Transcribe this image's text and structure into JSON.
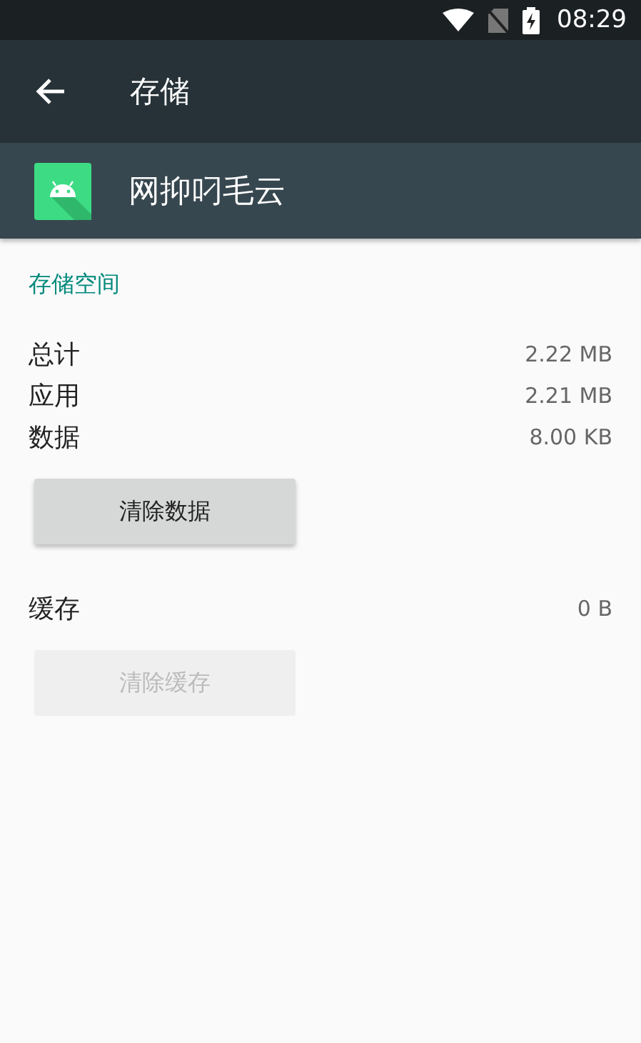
{
  "status_bar": {
    "time": "08:29"
  },
  "toolbar": {
    "title": "存储"
  },
  "app": {
    "name": "网抑叼毛云"
  },
  "section": {
    "title": "存储空间"
  },
  "usage_rows": [
    {
      "label": "总计",
      "value": "2.22 MB"
    },
    {
      "label": "应用",
      "value": "2.21 MB"
    },
    {
      "label": "数据",
      "value": "8.00 KB"
    }
  ],
  "clear_data_button": {
    "label": "清除数据",
    "disabled": false
  },
  "cache_row": {
    "label": "缓存",
    "value": "0 B"
  },
  "clear_cache_button": {
    "label": "清除缓存",
    "disabled": true
  }
}
